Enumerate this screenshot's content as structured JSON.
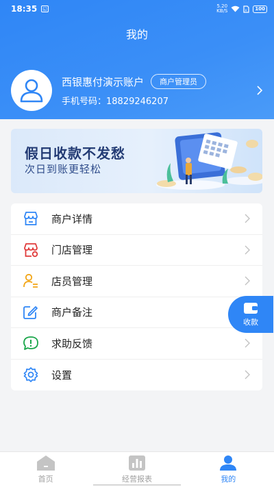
{
  "status_bar": {
    "time": "18:35",
    "indicator": "◱",
    "speed_top": "5.20",
    "speed_unit": "KB/S",
    "battery": "100"
  },
  "header": {
    "title": "我的"
  },
  "profile": {
    "name": "西银惠付演示账户",
    "role": "商户管理员",
    "phone_label": "手机号码：",
    "phone": "18829246207"
  },
  "banner": {
    "headline": "假日收款不发愁",
    "subline": "次日到账更轻松"
  },
  "menu": [
    {
      "label": "商户详情",
      "icon": "store-icon",
      "color": "#2f86f6"
    },
    {
      "label": "门店管理",
      "icon": "shop-settings-icon",
      "color": "#e03a3a"
    },
    {
      "label": "店员管理",
      "icon": "staff-icon",
      "color": "#f2a516"
    },
    {
      "label": "商户备注",
      "icon": "edit-icon",
      "color": "#2f86f6"
    },
    {
      "label": "求助反馈",
      "icon": "help-icon",
      "color": "#1aa64a"
    },
    {
      "label": "设置",
      "icon": "gear-icon",
      "color": "#2f86f6"
    }
  ],
  "fab": {
    "label": "收款",
    "icon": "wallet-icon"
  },
  "tabbar": [
    {
      "label": "首页",
      "icon": "home-icon",
      "active": false
    },
    {
      "label": "经营报表",
      "icon": "chart-icon",
      "active": false
    },
    {
      "label": "我的",
      "icon": "user-icon",
      "active": true
    }
  ],
  "colors": {
    "primary": "#2f86f6",
    "background": "#f3f4f6"
  }
}
